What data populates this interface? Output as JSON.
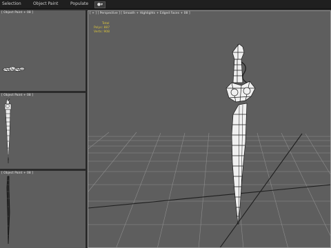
{
  "menubar": {
    "items": [
      "Selection",
      "Object Paint",
      "Populate"
    ],
    "icon": "dropdown-icon"
  },
  "viewports": {
    "top": {
      "label": "[ Object Paint + 08 ]"
    },
    "front": {
      "label": "[ Object Paint + 08 ]"
    },
    "side": {
      "label": "[ Object Paint + 08 ]"
    },
    "perspective": {
      "label": "[ + ] [ Perspective ] [ Smooth + Highlights + Edged Faces + 08 ]",
      "stats": {
        "title": "Total",
        "polys_label": "Polys:",
        "polys_value": "887",
        "verts_label": "Verts:",
        "verts_value": "908"
      }
    }
  },
  "colors": {
    "viewport_bg": "#5e5e5e",
    "hud_text": "#d8c23a",
    "grid": "#8a8a8a",
    "grid_axis": "#1e1e1e",
    "mesh_fill": "#f0f0f0",
    "mesh_wire": "#1a1a1a"
  }
}
